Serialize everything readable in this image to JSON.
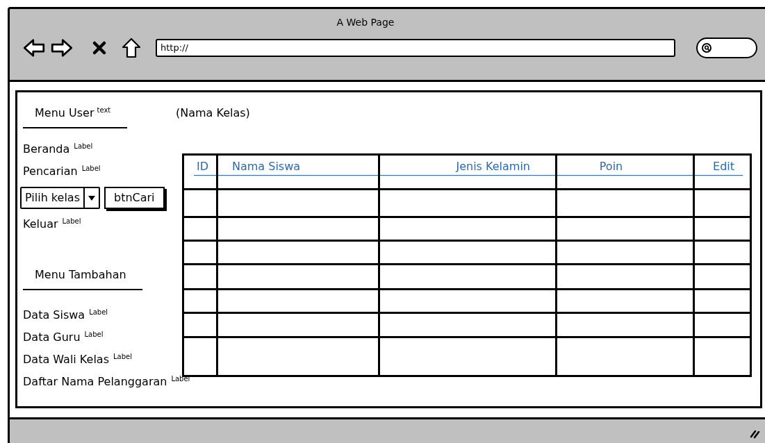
{
  "window": {
    "title": "A Web Page"
  },
  "address_bar": {
    "value": "http://"
  },
  "sidebar": {
    "sections": [
      {
        "title": "Menu User",
        "title_tag": "text",
        "items": [
          {
            "kind": "link",
            "label": "Beranda",
            "tag": "Label"
          },
          {
            "kind": "link",
            "label": "Pencarian",
            "tag": "Label"
          },
          {
            "kind": "search",
            "select": "Pilih kelas",
            "button": "btnCari"
          },
          {
            "kind": "link",
            "label": "Keluar",
            "tag": "Label"
          }
        ]
      },
      {
        "title": "Menu Tambahan",
        "items": [
          {
            "kind": "link",
            "label": "Data Siswa",
            "tag": "Label"
          },
          {
            "kind": "link",
            "label": "Data Guru",
            "tag": "Label"
          },
          {
            "kind": "link",
            "label": "Data Wali Kelas",
            "tag": "Label"
          },
          {
            "kind": "link",
            "label": "Daftar Nama Pelanggaran",
            "tag": "Label"
          }
        ]
      }
    ]
  },
  "heading": "(Nama Kelas)",
  "table": {
    "columns": [
      {
        "label": "ID"
      },
      {
        "label": "Nama Siswa"
      },
      {
        "label": "Jenis Kelamin"
      },
      {
        "label": "Poin"
      },
      {
        "label": "Edit"
      }
    ],
    "rows": [
      {
        "kind": "empty"
      },
      {
        "kind": "empty"
      },
      {
        "kind": "empty"
      },
      {
        "kind": "empty"
      },
      {
        "kind": "empty"
      },
      {
        "kind": "empty"
      },
      {
        "kind": "empty"
      }
    ]
  }
}
